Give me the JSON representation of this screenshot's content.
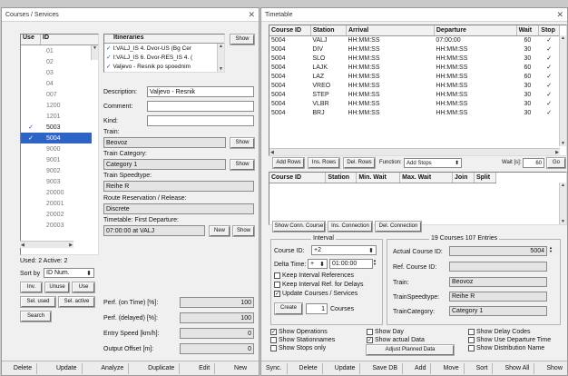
{
  "courses_window": {
    "title": "Courses / Services",
    "id_list": {
      "headers": [
        "Use",
        "ID"
      ],
      "rows": [
        {
          "use": "",
          "id": "01",
          "selected": false
        },
        {
          "use": "",
          "id": "02",
          "selected": false
        },
        {
          "use": "",
          "id": "03",
          "selected": false
        },
        {
          "use": "",
          "id": "04",
          "selected": false
        },
        {
          "use": "",
          "id": "007",
          "selected": false
        },
        {
          "use": "",
          "id": "1200",
          "selected": false
        },
        {
          "use": "",
          "id": "1201",
          "selected": false
        },
        {
          "use": "✓",
          "id": "5003",
          "selected": false
        },
        {
          "use": "✓",
          "id": "5004",
          "selected": true
        },
        {
          "use": "",
          "id": "9000",
          "selected": false
        },
        {
          "use": "",
          "id": "9001",
          "selected": false
        },
        {
          "use": "",
          "id": "9002",
          "selected": false
        },
        {
          "use": "",
          "id": "9003",
          "selected": false
        },
        {
          "use": "",
          "id": "20000",
          "selected": false
        },
        {
          "use": "",
          "id": "20001",
          "selected": false
        },
        {
          "use": "",
          "id": "20002",
          "selected": false
        },
        {
          "use": "",
          "id": "20003",
          "selected": false
        }
      ]
    },
    "used_active": "Used: 2 Active: 2",
    "sort_by_label": "Sort by",
    "sort_by_value": "ID Num.",
    "buttons": {
      "inv": "Inv.",
      "unuse": "Unuse",
      "use": "Use",
      "sel_used": "Sel. used",
      "sel_active": "Sel. active",
      "search": "Search"
    },
    "itineraries": {
      "header": "Itineraries",
      "show": "Show",
      "items": [
        "I:VALJ_IS 4. Dvor-US (Bg Cer",
        "I:VALJ_IS 6. Dvor-RES_IS 4. (",
        "Valjevo - Resnik po spoednim"
      ]
    },
    "description_label": "Description:",
    "description_value": "Valjevo - Resnik",
    "comment_label": "Comment:",
    "kind_label": "Kind:",
    "train_label": "Train:",
    "train_value": "Beovoz",
    "train_show": "Show",
    "train_category_label": "Train Category:",
    "train_category_value": "Category 1",
    "train_category_show": "Show",
    "train_speedtype_label": "Train Speedtype:",
    "train_speedtype_value": "Reihe R",
    "route_label": "Route Reservation / Release:",
    "route_value": "Discrete",
    "timetable_label": "Timetable: First Departure:",
    "timetable_value": "07:00:00 at VALJ",
    "new_button": "New",
    "show_button": "Show",
    "perf_on_time_label": "Perf. (on Time) [%]:",
    "perf_on_time_value": "100",
    "perf_delayed_label": "Perf. (delayed) [%]:",
    "perf_delayed_value": "100",
    "entry_speed_label": "Entry Speed [km/h]:",
    "entry_speed_value": "0",
    "output_offset_label": "Output Offset [m]:",
    "output_offset_value": "0",
    "bottom_buttons": [
      "Delete",
      "Update",
      "Analyze",
      "Duplicate",
      "Edit",
      "New"
    ]
  },
  "timetable_window": {
    "title": "Timetable",
    "columns": [
      "Course ID",
      "Station",
      "Arrival",
      "Departure",
      "Wait",
      "Stop"
    ],
    "rows": [
      [
        "5004",
        "VALJ",
        "HH:MM:SS",
        "07:00:00",
        "60",
        "✓"
      ],
      [
        "5004",
        "DIV",
        "HH:MM:SS",
        "HH:MM:SS",
        "30",
        "✓"
      ],
      [
        "5004",
        "SLO",
        "HH:MM:SS",
        "HH:MM:SS",
        "30",
        "✓"
      ],
      [
        "5004",
        "LAJK",
        "HH:MM:SS",
        "HH:MM:SS",
        "60",
        "✓"
      ],
      [
        "5004",
        "LAZ",
        "HH:MM:SS",
        "HH:MM:SS",
        "60",
        "✓"
      ],
      [
        "5004",
        "VREO",
        "HH:MM:SS",
        "HH:MM:SS",
        "30",
        "✓"
      ],
      [
        "5004",
        "STEP",
        "HH:MM:SS",
        "HH:MM:SS",
        "30",
        "✓"
      ],
      [
        "5004",
        "VLBR",
        "HH:MM:SS",
        "HH:MM:SS",
        "30",
        "✓"
      ],
      [
        "5004",
        "BRJ",
        "HH:MM:SS",
        "HH:MM:SS",
        "30",
        "✓"
      ]
    ],
    "row_buttons": {
      "add_rows": "Add Rows",
      "ins_rows": "Ins. Rows",
      "del_rows": "Del. Rows",
      "function_label": "Function:",
      "function_value": "Add Stops",
      "wait_label": "Wait [s]:",
      "wait_value": "60",
      "go": "Go"
    },
    "conn_columns": [
      "Course ID",
      "Station",
      "Min. Wait",
      "Max. Wait",
      "Join",
      "Split"
    ],
    "conn_buttons": [
      "Show Conn. Course",
      "Ins. Connection",
      "Del. Connection"
    ],
    "interval": {
      "title": "Interval",
      "course_id_label": "Course ID:",
      "course_id_value": "+2",
      "delta_time_label": "Delta Time:",
      "delta_sign": "+",
      "delta_value": "01:00:00",
      "keep_refs": "Keep Interval References",
      "keep_ref_delays": "Keep Interval Ref. for Delays",
      "update_courses": "Update Courses / Services",
      "create": "Create",
      "count": "1",
      "courses": "Courses"
    },
    "summary": {
      "title": "19 Courses 107 Entries",
      "actual_course_id_label": "Actual Course ID:",
      "actual_course_id_value": "5004",
      "ref_course_id_label": "Ref. Course ID:",
      "train_label": "Train:",
      "train_value": "Beovoz",
      "speedtype_label": "TrainSpeedtype:",
      "speedtype_value": "Reihe R",
      "category_label": "TrainCategory:",
      "category_value": "Category 1"
    },
    "options": {
      "show_operations": "Show Operations",
      "show_stationnames": "Show Stationnames",
      "show_stops_only": "Show Stops only",
      "show_day": "Show Day",
      "show_actual_data": "Show actual Data",
      "adjust_planned": "Adjust Planned Data",
      "show_delay_codes": "Show Delay Codes",
      "show_use_departure": "Show Use Departure Time",
      "show_distribution": "Show Distribution Name"
    },
    "bottom_buttons": [
      "Sync.",
      "Delete",
      "Update",
      "Save DB",
      "Add",
      "Move",
      "Sort",
      "Show All",
      "Show"
    ]
  }
}
